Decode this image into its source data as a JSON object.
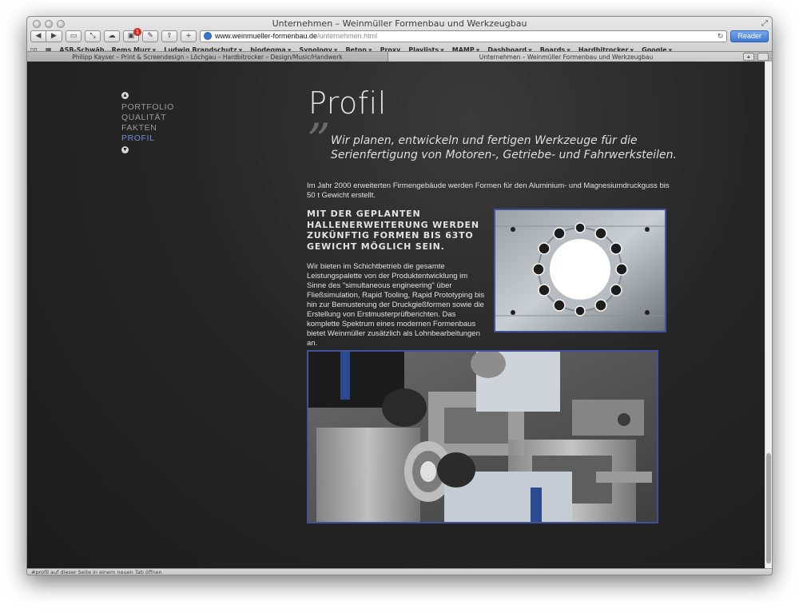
{
  "window": {
    "title": "Unternehmen – Weinmüller Formenbau und Werkzeugbau"
  },
  "toolbar": {
    "badge_count": "1",
    "address_host": "www.weinmueller-formenbau.de",
    "address_path": "/unternehmen.html",
    "reader_label": "Reader",
    "add_label": "+"
  },
  "bookmarks": [
    "ASB-Schwäb...Rems Murr",
    "Ludwig Brandschutz",
    "biodegma",
    "Synology",
    "Beton",
    "Proxy",
    "Playlists",
    "MAMP",
    "Dashboard",
    "Boards",
    "Hardbitrocker",
    "Google"
  ],
  "bookmark_has_menu": [
    true,
    true,
    true,
    true,
    true,
    false,
    true,
    true,
    true,
    true,
    true,
    true
  ],
  "tabs": [
    {
      "label": "Philipp Kayser – Print & Screendesign – Löchgau – Hardbitrocker – Design/Music/Handwerk",
      "active": false
    },
    {
      "label": "Unternehmen – Weinmüller Formenbau und Werkzeugbau",
      "active": true
    }
  ],
  "side_nav": {
    "items": [
      {
        "label": "PORTFOLIO",
        "active": false
      },
      {
        "label": "QUALITÄT",
        "active": false
      },
      {
        "label": "FAKTEN",
        "active": false
      },
      {
        "label": "PROFIL",
        "active": true
      }
    ]
  },
  "page": {
    "title": "Profil",
    "quote": "Wir planen, entwickeln und fertigen Werkzeuge für die Serienfertigung von Motoren-, Getriebe- und Fahrwerksteilen.",
    "intro": "Im Jahr 2000 erweiterten Firmengebäude werden Formen für den Aluminium- und Magnesiumdruckguss bis 50 t Gewicht erstellt.",
    "headline": "Mit der geplanten Hallenerweiterung werden zukünftig Formen bis 63to Gewicht möglich sein.",
    "body": "Wir bieten im Schichtbetrieb die gesamte Leistungspalette von der Produktentwicklung im Sinne des \"simultaneous engineering\" über Fließsimulation, Rapid Tooling, Rapid Prototyping bis hin zur Bemusterung der Druckgießformen sowie die Erstellung von Erstmusterprüfberichten. Das komplette Spektrum eines modernen Formenbaus bietet Weinmüller zusätzlich als Lohnbearbeitungen an."
  },
  "status_bar": "#profil auf dieser Seite in einem neuen Tab öffnen",
  "colors": {
    "accent_nav_active": "#6f8fd8",
    "image_border": "#43519a",
    "page_background": "#222222"
  }
}
